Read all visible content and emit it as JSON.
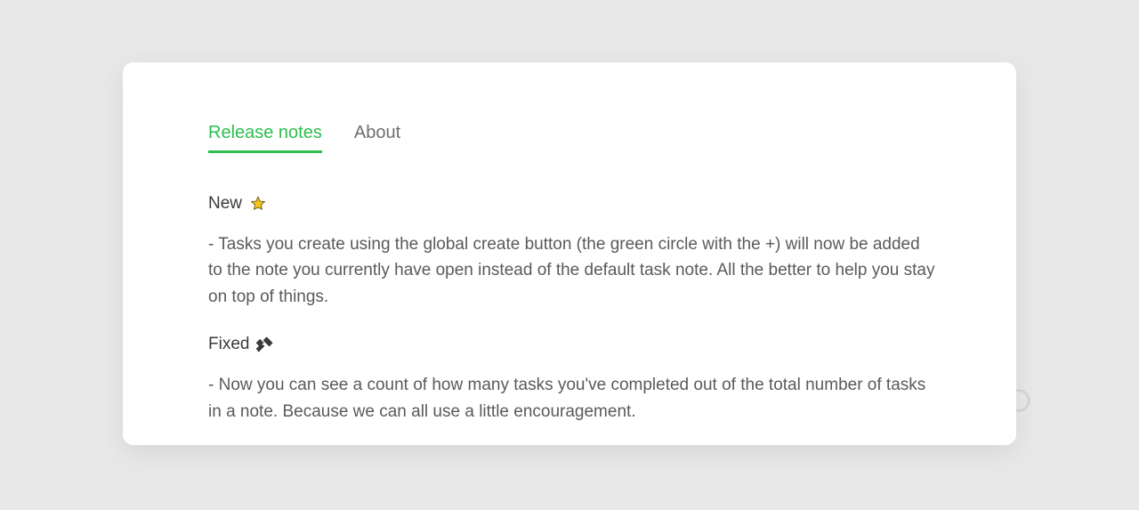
{
  "tabs": {
    "release_notes": {
      "label": "Release notes",
      "active": true
    },
    "about": {
      "label": "About",
      "active": false
    }
  },
  "sections": {
    "new": {
      "title": "New",
      "icon": "star-icon",
      "items": [
        "- Tasks you create using the global create button (the green circle with the +) will now be added to the note you currently have open instead of the default task note. All the better to help you stay on top of things."
      ]
    },
    "fixed": {
      "title": "Fixed",
      "icon": "tools-icon",
      "items": [
        "- Now you can see a count of how many tasks you've completed out of the total number of tasks in a note. Because we can all use a little encouragement."
      ]
    }
  },
  "colors": {
    "accent": "#2dbe4e"
  }
}
